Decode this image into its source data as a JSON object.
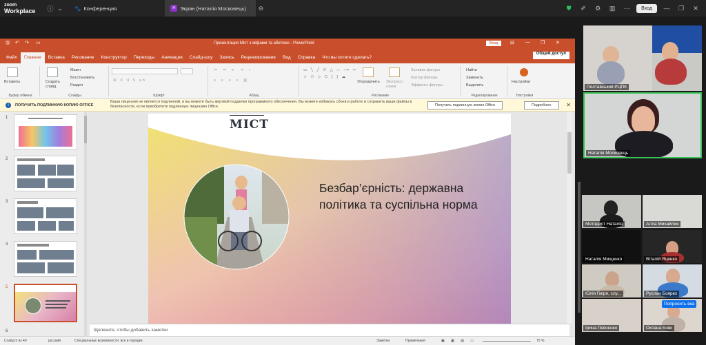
{
  "zoom": {
    "logo_line1": "zoom",
    "logo_line2": "Workplace",
    "tab1": "Конференция",
    "tab2": "Экран (Наталія Московець)",
    "tab2_badge": "Н",
    "signin": "Вход"
  },
  "ppt": {
    "title": "Презентация Міст з міфами та абеткою - PowerPoint",
    "signin": "Вход",
    "tabs": [
      "Файл",
      "Главная",
      "Вставка",
      "Рисование",
      "Конструктор",
      "Переходы",
      "Анимация",
      "Слайд-шоу",
      "Запись",
      "Рецензирование",
      "Вид",
      "Справка",
      "Что вы хотите сделать?"
    ],
    "share": "Общий доступ",
    "ribbon": {
      "paste": "Вставить",
      "clipboard": "Буфер обмена",
      "new_slide": "Создать слайд",
      "layout": "Макет",
      "reset": "Восстановить",
      "section": "Раздел",
      "slides": "Слайды",
      "font": "Шрифт",
      "paragraph": "Абзац",
      "arrange": "Упорядочить",
      "quick_styles": "Экспресс-стили",
      "fill": "Заливка фигуры",
      "outline": "Контур фигуры",
      "effects": "Эффекты фигуры",
      "drawing": "Рисование",
      "find": "Найти",
      "replace": "Заменить",
      "select": "Выделить",
      "editing": "Редактирование",
      "settings": "Настройки"
    },
    "infobar": {
      "title": "ПОЛУЧИТЬ ПОДЛИННУЮ КОПИЮ OFFICE",
      "text": "Ваша лицензия не является подлинной, и вы можете быть жертвой подделки программного обеспечения. Вы можете избежать сбоев в работе и сохранить ваши файлы в безопасности, если приобретете подлинную лицензию Office.",
      "btn_get": "Получить подлинную копию Office",
      "btn_more": "Подробнее"
    },
    "slide_numbers": [
      "1",
      "2",
      "3",
      "4",
      "5",
      "6"
    ],
    "slide": {
      "logo": "МІСТ",
      "heading": "Безбар’єрність: державна політика та суспільна норма"
    },
    "notes_placeholder": "Щелкните, чтобы добавить заметки",
    "status": {
      "slide": "Слайд 5 из 40",
      "lang": "русский",
      "accessibility": "Специальные возможности: все в порядке",
      "notes": "Заметки",
      "comments": "Примечания",
      "zoom": "75 %"
    }
  },
  "participants": [
    {
      "name": "Полтавський РЦПК"
    },
    {
      "name": "Наталія Московець"
    },
    {
      "name": "Методист Наталія"
    },
    {
      "name": "Алла Михайлик"
    },
    {
      "name": "Наталія Мищенко"
    },
    {
      "name": "Віталій Яценко"
    },
    {
      "name": "Юлія Гміря, слу..."
    },
    {
      "name": "Руслан Бояркo"
    },
    {
      "name": "Ірина Левченко"
    },
    {
      "name": "Оксана Бовк"
    }
  ],
  "raise_hand": "Попросить вка"
}
